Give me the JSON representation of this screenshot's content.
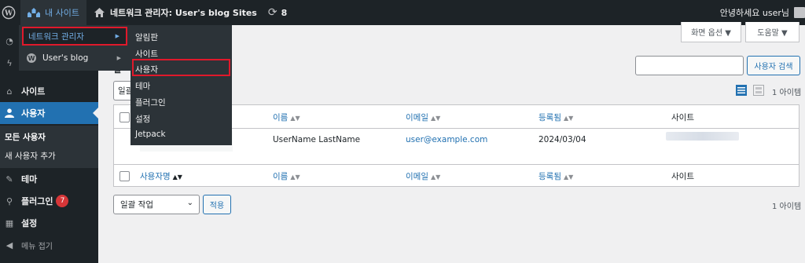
{
  "adminbar": {
    "wp_icon": "wordpress-icon",
    "my_sites": "내 사이트",
    "site_title": "네트워크 관리자: User's blog Sites",
    "updates_count": "8",
    "greeting": "안녕하세요 user님"
  },
  "menu_network": {
    "network_admin": "네트워크 관리자",
    "users_blog": "User's blog"
  },
  "menu_network_sub": {
    "items": [
      "알림판",
      "사이트",
      "사용자",
      "테마",
      "플러그인",
      "설정",
      "Jetpack"
    ]
  },
  "sidebar": {
    "sites": "사이트",
    "users": "사용자",
    "all_users": "모든 사용자",
    "add_user": "새 사용자 추가",
    "themes": "테마",
    "plugins": "플러그인",
    "plugins_badge": "7",
    "settings": "설정",
    "collapse": "메뉴 접기"
  },
  "toolbar": {
    "screen_options": "화면 옵션 ▼",
    "help": "도움말 ▼",
    "search_button": "사용자 검색",
    "bulk_partial": "일괄",
    "heading_partial": "일",
    "item_count": "1 아이템"
  },
  "table": {
    "headers": [
      "사용자명",
      "이름",
      "이메일",
      "등록됨",
      "사이트"
    ],
    "row": {
      "name": "UserName LastName",
      "email": "user@example.com",
      "registered": "2024/03/04"
    }
  },
  "bottom": {
    "bulk_action": "일괄 작업",
    "apply": "적용",
    "item_count": "1 아이템"
  }
}
